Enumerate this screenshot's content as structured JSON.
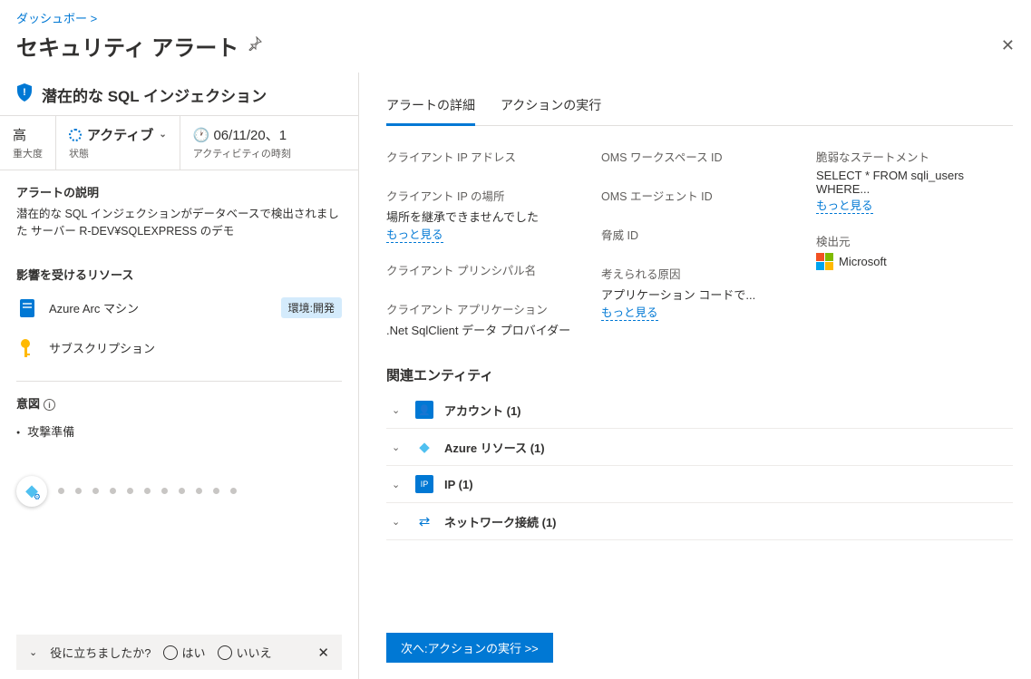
{
  "breadcrumb": {
    "dashboard": "ダッシュボー",
    "sep": ">"
  },
  "page_title": "セキュリティ アラート",
  "alert": {
    "title": "潜在的な SQL インジェクション",
    "severity_value": "高",
    "severity_label": "重大度",
    "status_value": "アクティブ",
    "status_label": "状態",
    "time_value": "06/11/20、1",
    "time_label": "アクティビティの時刻"
  },
  "description": {
    "title": "アラートの説明",
    "body": "潜在的な SQL インジェクションがデータベースで検出されました サーバー R-DEV¥SQLEXPRESS のデモ"
  },
  "affected": {
    "title": "影響を受けるリソース",
    "arc": "Azure Arc マシン",
    "env_badge": "環境:開発",
    "sub": "サブスクリプション"
  },
  "intent": {
    "title": "意図",
    "item": "攻撃準備"
  },
  "feedback": {
    "question": "役に立ちましたか?",
    "yes": "はい",
    "no": "いいえ"
  },
  "tabs": {
    "details": "アラートの詳細",
    "actions": "アクションの実行"
  },
  "details": {
    "client_ip_label": "クライアント IP アドレス",
    "client_ip_loc_label": "クライアント IP の場所",
    "client_ip_loc_value": "場所を継承できませんでした",
    "more": "もっと見る",
    "principal_label": "クライアント プリンシパル名",
    "client_app_label": "クライアント アプリケーション",
    "client_app_value": ".Net SqlClient データ プロバイダー",
    "oms_workspace_label": "OMS ワークスペース ID",
    "oms_agent_label": "OMS エージェント ID",
    "threat_id_label": "脅威 ID",
    "cause_label": "考えられる原因",
    "cause_value": "アプリケーション コードで...",
    "vuln_label": "脆弱なステートメント",
    "vuln_value": "SELECT * FROM sqli_users WHERE...",
    "detected_label": "検出元",
    "detected_value": "Microsoft"
  },
  "entities": {
    "title": "関連エンティティ",
    "account": "アカウント (1)",
    "azure": "Azure リソース (1)",
    "ip": "IP (1)",
    "net": "ネットワーク接続 (1)"
  },
  "footer": {
    "next_action": "次へ:アクションの実行  >>"
  }
}
